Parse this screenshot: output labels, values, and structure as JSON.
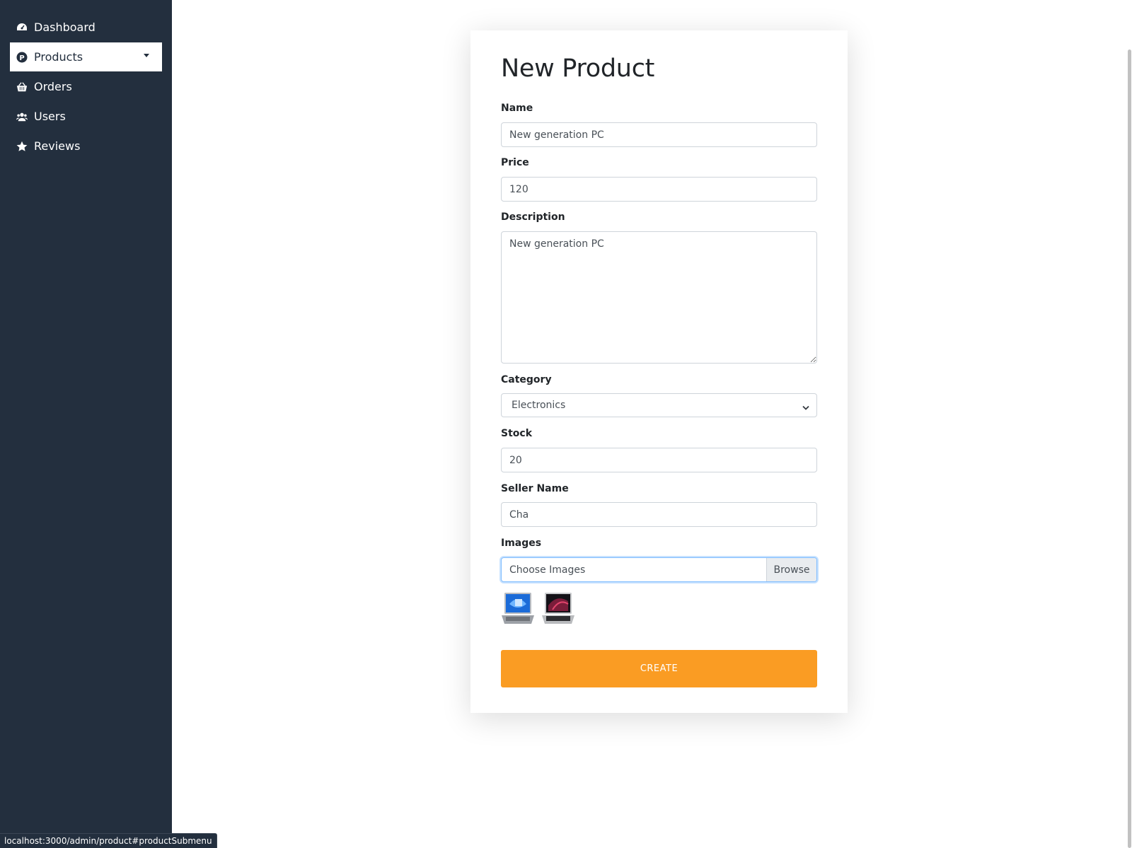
{
  "sidebar": {
    "items": [
      {
        "label": "Dashboard",
        "icon": "dashboard-icon"
      },
      {
        "label": "Products",
        "icon": "product-p-icon",
        "active": true
      },
      {
        "label": "Orders",
        "icon": "basket-icon"
      },
      {
        "label": "Users",
        "icon": "users-icon"
      },
      {
        "label": "Reviews",
        "icon": "star-icon"
      }
    ]
  },
  "form": {
    "title": "New Product",
    "name": {
      "label": "Name",
      "value": "New generation PC"
    },
    "price": {
      "label": "Price",
      "value": "120"
    },
    "description": {
      "label": "Description",
      "value": "New generation PC"
    },
    "category": {
      "label": "Category",
      "value": "Electronics"
    },
    "stock": {
      "label": "Stock",
      "value": "20"
    },
    "seller": {
      "label": "Seller Name",
      "value": "Cha"
    },
    "images": {
      "label": "Images",
      "placeholder": "Choose Images",
      "browse": "Browse"
    },
    "create_label": "CREATE"
  },
  "status_url": "localhost:3000/admin/product#productSubmenu",
  "colors": {
    "sidebar": "#232f3e",
    "accent": "#fa9c23"
  }
}
